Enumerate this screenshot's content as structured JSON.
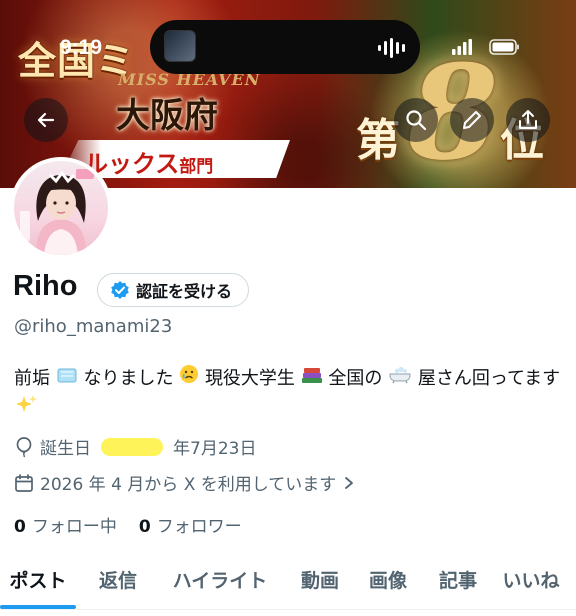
{
  "status_bar": {
    "time": "9:19"
  },
  "banner": {
    "title": "全国ミ",
    "subtitle": "MISS HEAVEN",
    "prefecture": "大阪府",
    "category_main": "ルックス",
    "category_suffix": "部門",
    "rank_prefix": "第",
    "rank_number": "8",
    "rank_suffix": "位"
  },
  "toolbar": {
    "back_icon": "arrow-left-icon",
    "search_icon": "search-icon",
    "edit_icon": "pencil-icon",
    "share_icon": "share-icon"
  },
  "profile": {
    "display_name": "Riho",
    "verify_button": "認証を受ける",
    "handle": "@riho_manami23",
    "bio_part1": "前垢",
    "bio_part2": "なりました",
    "bio_part3": "現役大学生",
    "bio_part4": "全国の",
    "bio_part5": "屋さん回ってます",
    "birthday_label": "誕生日",
    "birthday_date": "年7月23日",
    "joined": "2026 年 4 月から X を利用しています",
    "following_count": "0",
    "following_label": "フォロー中",
    "followers_count": "0",
    "followers_label": "フォロワー"
  },
  "tabs": [
    {
      "label": "ポスト"
    },
    {
      "label": "返信"
    },
    {
      "label": "ハイライト"
    },
    {
      "label": "動画"
    },
    {
      "label": "画像"
    },
    {
      "label": "記事"
    },
    {
      "label": "いいね"
    }
  ],
  "colors": {
    "accent": "#1d9bf0",
    "verified_badge": "#1d9bf0",
    "secondary_text": "#536471"
  }
}
